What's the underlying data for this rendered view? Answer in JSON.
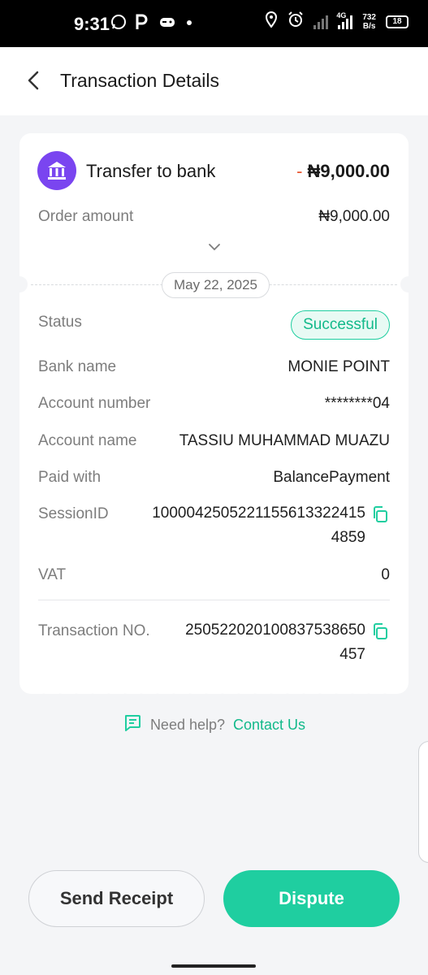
{
  "status_bar": {
    "time": "9:31",
    "network_label": "4G",
    "speed": "732",
    "speed_unit": "B/s",
    "battery": "18"
  },
  "header": {
    "title": "Transaction Details"
  },
  "transaction": {
    "title": "Transfer to bank",
    "amount_sign": "-",
    "amount": "₦9,000.00",
    "order_amount_label": "Order amount",
    "order_amount_value": "₦9,000.00",
    "date": "May 22, 2025"
  },
  "details": {
    "status_label": "Status",
    "status_value": "Successful",
    "bank_name_label": "Bank name",
    "bank_name_value": "MONIE POINT",
    "account_number_label": "Account number",
    "account_number_value": "********04",
    "account_name_label": "Account name",
    "account_name_value": "TASSIU MUHAMMAD MUAZU",
    "paid_with_label": "Paid with",
    "paid_with_value": "BalancePayment",
    "session_id_label": "SessionID",
    "session_id_line1": "1000042505221155613322415",
    "session_id_line2": "4859",
    "vat_label": "VAT",
    "vat_value": "0",
    "transaction_no_label": "Transaction NO.",
    "transaction_no_line1": "250522020100837538650",
    "transaction_no_line2": "457"
  },
  "help": {
    "prefix": "Need help?",
    "link": "Contact Us"
  },
  "actions": {
    "send_receipt": "Send Receipt",
    "dispute": "Dispute"
  },
  "colors": {
    "accent": "#1fcea0",
    "bank_icon_bg": "#7a45f0",
    "minus": "#e8542d"
  }
}
